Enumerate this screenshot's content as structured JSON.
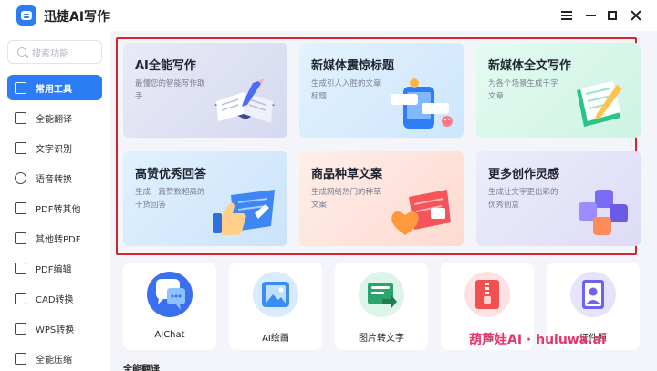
{
  "app": {
    "title": "迅捷AI写作"
  },
  "sidebar": {
    "search_placeholder": "搜索功能",
    "items": [
      {
        "label": "常用工具",
        "icon": "toolbox-icon",
        "active": true
      },
      {
        "label": "全能翻译",
        "icon": "translate-icon",
        "active": false
      },
      {
        "label": "文字识别",
        "icon": "text-recognition-icon",
        "active": false
      },
      {
        "label": "语音转换",
        "icon": "voice-icon",
        "active": false
      },
      {
        "label": "PDF转其他",
        "icon": "pdf-export-icon",
        "active": false
      },
      {
        "label": "其他转PDF",
        "icon": "pdf-import-icon",
        "active": false
      },
      {
        "label": "PDF编辑",
        "icon": "pdf-edit-icon",
        "active": false
      },
      {
        "label": "CAD转换",
        "icon": "cad-icon",
        "active": false
      },
      {
        "label": "WPS转换",
        "icon": "wps-icon",
        "active": false
      },
      {
        "label": "全能压缩",
        "icon": "compress-icon",
        "active": false
      }
    ]
  },
  "cards": [
    {
      "title": "AI全能写作",
      "desc": "最懂您的智能写作助手",
      "icon": "notebook-pen-icon"
    },
    {
      "title": "新媒体震惊标题",
      "desc": "生成引人入胜的文章标题",
      "icon": "phone-emoji-icon"
    },
    {
      "title": "新媒体全文写作",
      "desc": "为各个场景生成千字文章",
      "icon": "document-pen-icon"
    },
    {
      "title": "高赞优秀回答",
      "desc": "生成一篇赞数超高的干货回答",
      "icon": "thumbs-up-icon"
    },
    {
      "title": "商品种草文案",
      "desc": "生成网络热门的种草文案",
      "icon": "heart-cards-icon"
    },
    {
      "title": "更多创作灵感",
      "desc": "生成让文字更出彩的优秀创意",
      "icon": "blocks-icon"
    }
  ],
  "tools": [
    {
      "label": "AIChat",
      "icon": "chat-bubble-icon"
    },
    {
      "label": "AI绘画",
      "icon": "image-frame-icon"
    },
    {
      "label": "图片转文字",
      "icon": "image-to-text-icon"
    },
    {
      "label": "图",
      "icon": "image-compress-icon"
    },
    {
      "label": "证件照",
      "icon": "id-photo-icon"
    }
  ],
  "section_title": "全能翻译",
  "watermark": "葫芦娃AI · huluwa.ai",
  "colors": {
    "accent": "#2c7cf6",
    "highlight_border": "#d8232a",
    "watermark": "#e8356b"
  }
}
